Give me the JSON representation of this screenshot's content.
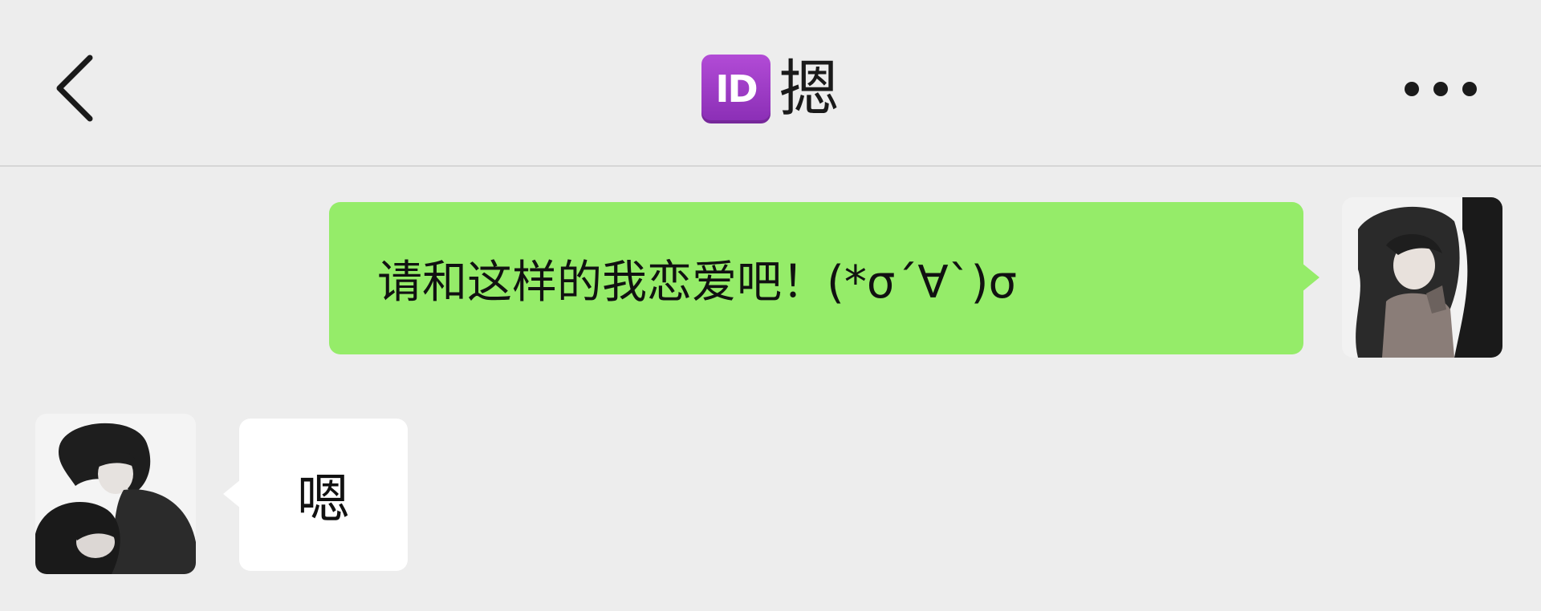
{
  "header": {
    "back_icon": "chevron-left-icon",
    "title_badge": "ID",
    "title_name": "摁",
    "more_icon": "more-horizontal-icon"
  },
  "messages": [
    {
      "side": "right",
      "text": "请和这样的我恋爱吧！(*σ´∀`)σ",
      "bubble_color": "#95ec69"
    },
    {
      "side": "left",
      "text": "嗯",
      "bubble_color": "#ffffff"
    }
  ],
  "colors": {
    "background": "#ededed",
    "badge": "#9b3dc4"
  }
}
